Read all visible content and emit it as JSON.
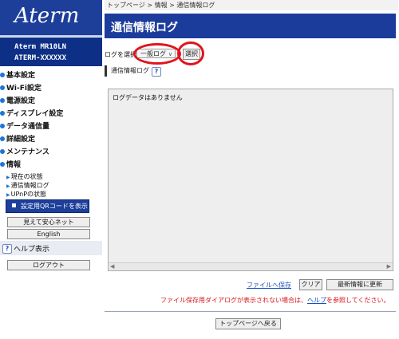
{
  "sidebar": {
    "logo": "Aterm",
    "model_line1": "Aterm  MR10LN",
    "model_line2": "ATERM-XXXXXX",
    "nav": [
      {
        "label": "基本設定"
      },
      {
        "label": "Wi-Fi設定"
      },
      {
        "label": "電源設定"
      },
      {
        "label": "ディスプレイ設定"
      },
      {
        "label": "データ通信量"
      },
      {
        "label": "詳細設定"
      },
      {
        "label": "メンテナンス"
      },
      {
        "label": "情報"
      }
    ],
    "info_sub": [
      "現在の状態",
      "通信情報ログ",
      "UPnPの状態"
    ],
    "qr_button": "設定用QRコードを表示",
    "mieru_button": "見えて安心ネット",
    "english_button": "English",
    "help_label": "ヘルプ表示",
    "logout_button": "ログアウト"
  },
  "main": {
    "breadcrumb": "トップページ > 情報 > 通信情報ログ",
    "title": "通信情報ログ",
    "log_select_label": "ログを選択",
    "log_select_value": "一般ログ",
    "select_button": "選択",
    "section_title": "通信情報ログ",
    "log_text": "ログデータはありません",
    "file_save_link": "ファイルへ保存",
    "clear_button": "クリア",
    "refresh_button": "最新情報に更新",
    "notice_before": "ファイル保存用ダイアログが表示されない場合は、",
    "notice_link": "ヘルプ",
    "notice_after": "を参照してください。",
    "back_button": "トップページへ戻る"
  },
  "colors": {
    "brand_blue": "#1d3f9a",
    "title_blue": "#1c3c9c",
    "highlight_red": "#e0141d",
    "link_blue": "#1a4fc4",
    "notice_red": "#d8141b"
  },
  "icons": [
    "bullet-dot-icon",
    "qr-code-icon",
    "help-question-icon",
    "dropdown-caret-icon"
  ]
}
